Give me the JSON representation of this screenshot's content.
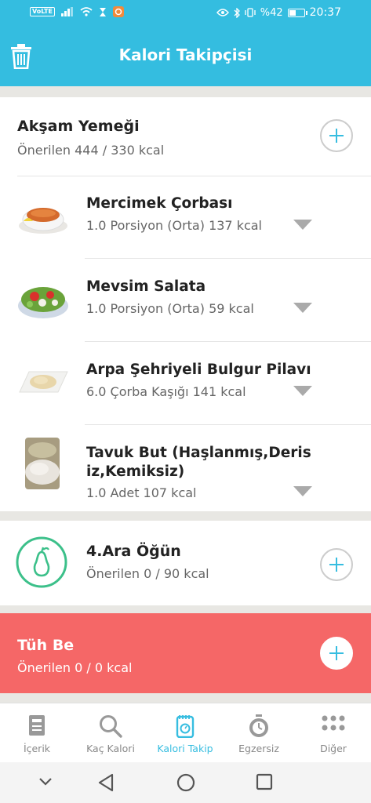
{
  "status_bar": {
    "volte": "VoLTE",
    "battery": "%42",
    "time": "20:37"
  },
  "app_bar": {
    "title": "Kalori Takipçisi"
  },
  "dinner": {
    "title": "Akşam Yemeği",
    "subtitle": "Önerilen 444 / 330 kcal",
    "items": [
      {
        "name": "Mercimek Çorbası",
        "amount": "1.0 Porsiyon (Orta) 137 kcal"
      },
      {
        "name": "Mevsim Salata",
        "amount": "1.0 Porsiyon (Orta) 59 kcal"
      },
      {
        "name": "Arpa Şehriyeli Bulgur Pilavı",
        "amount": "6.0 Çorba Kaşığı 141 kcal"
      },
      {
        "name": "Tavuk But (Haşlanmış,Deris iz,Kemiksiz)",
        "amount": "1.0 Adet 107 kcal"
      }
    ]
  },
  "snack": {
    "title": "4.Ara Öğün",
    "subtitle": "Önerilen 0 / 90 kcal"
  },
  "tuh_be": {
    "title": "Tüh Be",
    "subtitle": "Önerilen 0 / 0 kcal"
  },
  "bottom_nav": {
    "items": [
      {
        "label": "İçerik",
        "icon": "document-icon"
      },
      {
        "label": "Kaç Kalori",
        "icon": "search-icon"
      },
      {
        "label": "Kalori Takip",
        "icon": "scale-notebook-icon"
      },
      {
        "label": "Egzersiz",
        "icon": "stopwatch-icon"
      },
      {
        "label": "Diğer",
        "icon": "more-dots-icon"
      }
    ]
  },
  "colors": {
    "primary": "#34bde0",
    "tuh_be_red": "#f56767",
    "snack_green": "#3cc08a"
  }
}
